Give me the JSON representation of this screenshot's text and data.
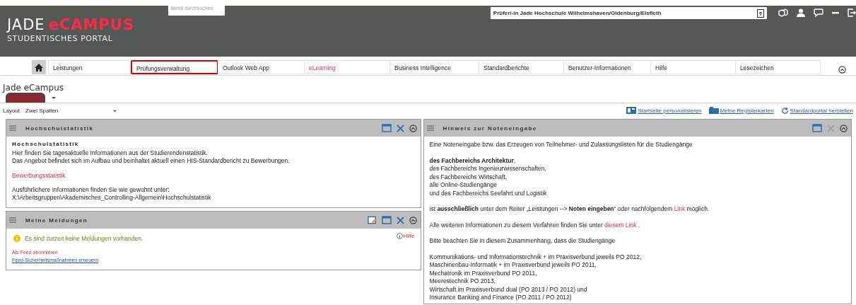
{
  "header": {
    "logo_main": "JADE",
    "logo_accent": "eCAMPUS",
    "logo_sub": "STUDENTISCHES PORTAL",
    "menu_search": {
      "placeholder": "Menü durchsuchen"
    },
    "role_field": {
      "value": "Prüfer/-in Jade Hochschule Wilhelmshaven/Oldenburg/Elsfleth"
    }
  },
  "nav": [
    {
      "label": "Leistungen",
      "highlighted": false,
      "accent": false
    },
    {
      "label": "Prüfungsverwaltung",
      "highlighted": true,
      "accent": false
    },
    {
      "label": "Outlook Web App",
      "highlighted": false,
      "accent": false
    },
    {
      "label": "eLearning",
      "highlighted": false,
      "accent": true
    },
    {
      "label": "Business Intelligence",
      "highlighted": false,
      "accent": false
    },
    {
      "label": "Standardberichte",
      "highlighted": false,
      "accent": false
    },
    {
      "label": "Benutzer-Informationen",
      "highlighted": false,
      "accent": false
    },
    {
      "label": "Hilfe",
      "highlighted": false,
      "accent": false
    },
    {
      "label": "Lesezeichen",
      "highlighted": false,
      "accent": false
    }
  ],
  "page_title": "Jade eCampus",
  "layout": {
    "label": "Layout",
    "value": "Zwei Spalten"
  },
  "actions": [
    "Startseite personalisieren",
    "Meine Registerkarten",
    "Standardportal herstellen"
  ],
  "left": [
    {
      "kind": "stats",
      "title": "Hochschulstatistik",
      "heading": "Hochschulstatistik",
      "lines": [
        "Hier finden Sie tagesaktuelle Informationen aus der Studierendenstatistik.",
        "Das Angebot befindet sich im Aufbau und beinhaltet aktuell einen HIS-Standardbericht zu Bewerbungen."
      ],
      "link": "Bewerbungsstatistik",
      "more": [
        "Ausführlichere Informationen finden Sie wie gewohnt unter:",
        "X:\\Arbeitsgruppen\\Akademisches_Controlling-Allgemein\\Hochschulstatistik"
      ]
    },
    {
      "kind": "messages",
      "title": "Meine Meldungen",
      "notice": "Es sind zurzeit keine Meldungen vorhanden.",
      "help": "Hilfe",
      "feed": "Als Feed abonnieren",
      "renew": "Feed-Sicherheitsmaßnahmen erneuern"
    }
  ],
  "right": {
    "title": "Hinweis zur Noteneingabe",
    "paragraphs": [
      [
        {
          "kind": "text",
          "text": "Eine Noteneingabe bzw. das Erzeugen von Teilnehmer- und Zulassungslisten für die Studiengänge"
        }
      ],
      [
        {
          "kind": "text",
          "text": "**des Fachbereichs Architektur**,\ndes Fachbereichs Ingenieurwissenschaften,\ndes Fachbereichs Wirtschaft,\nalle Online-Studiengänge\nund des Fachbereichs Seefahrt und Logistik"
        }
      ],
      [
        {
          "kind": "text",
          "text": "ist **ausschließlich** unter dem Reiter „Leistungen --> **Noten eingeben**“ oder nachfolgendem "
        },
        {
          "kind": "link",
          "text": "Link"
        },
        {
          "kind": "text",
          "text": " möglich."
        }
      ],
      [
        {
          "kind": "text",
          "text": "Alle weiteren Informationen zu diesem Verfahren finden Sie unter "
        },
        {
          "kind": "link",
          "text": "diesem Link"
        },
        {
          "kind": "text",
          "text": " ."
        }
      ],
      [
        {
          "kind": "text",
          "text": "Bitte beachten Sie in diesem Zusammenhang, dass die Studiengänge"
        }
      ],
      [
        {
          "kind": "text",
          "text": "Kommunikations- und Informationstechnik + im Praxisverbund jeweils PO 2012,\nMaschinenbau-Informatik + im Praxisverbund jeweils PO 2011,\nMechatronik im Praxisverbund PO 2011,\nMeerestechnik PO 2013,\nWirtschaft im Praxisverbund dual (PO 2013 / PO 2012) und\nInsurance Banking and Finance (PO 2011 / PO 2012)"
        }
      ]
    ]
  }
}
